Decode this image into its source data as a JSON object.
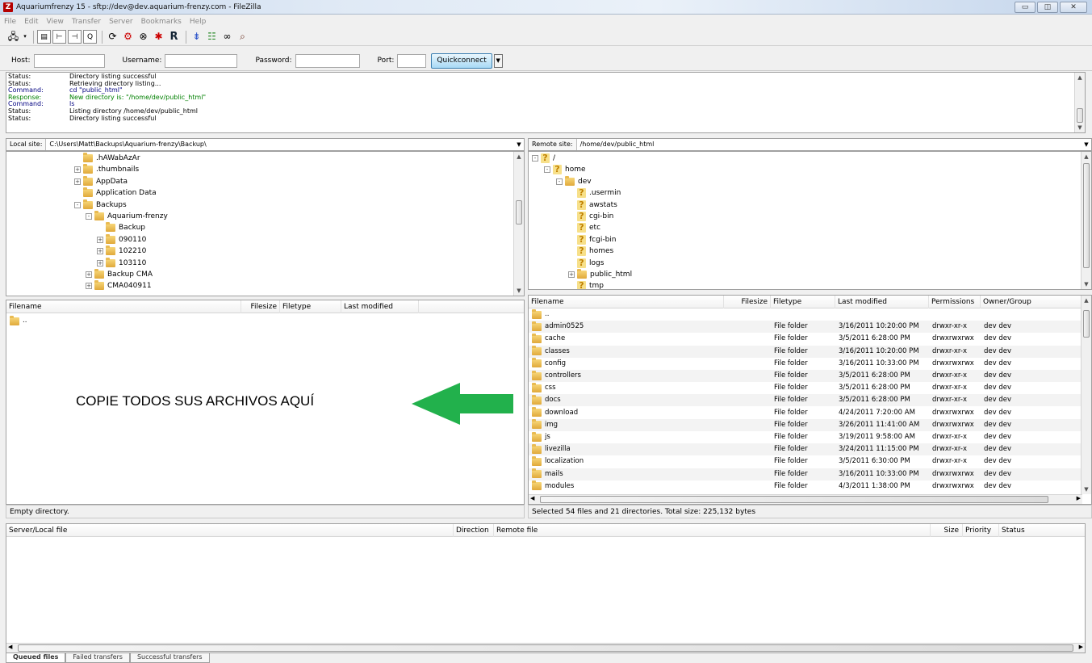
{
  "window": {
    "title": "Aquariumfrenzy 15 - sftp://dev@dev.aquarium-frenzy.com - FileZilla",
    "app_icon": "Z"
  },
  "menu": [
    "File",
    "Edit",
    "View",
    "Transfer",
    "Server",
    "Bookmarks",
    "Help"
  ],
  "quickconnect": {
    "host_label": "Host:",
    "host_value": "",
    "username_label": "Username:",
    "username_value": "",
    "password_label": "Password:",
    "password_value": "",
    "port_label": "Port:",
    "port_value": "",
    "button_label": "Quickconnect"
  },
  "message_log": [
    {
      "type": "Status:",
      "text": "Directory listing successful",
      "color": "black"
    },
    {
      "type": "Status:",
      "text": "Retrieving directory listing...",
      "color": "black"
    },
    {
      "type": "Command:",
      "text": "cd \"public_html\"",
      "color": "blue"
    },
    {
      "type": "Response:",
      "text": "New directory is: \"/home/dev/public_html\"",
      "color": "green"
    },
    {
      "type": "Command:",
      "text": "ls",
      "color": "blue"
    },
    {
      "type": "Status:",
      "text": "Listing directory /home/dev/public_html",
      "color": "black"
    },
    {
      "type": "Status:",
      "text": "Directory listing successful",
      "color": "black"
    }
  ],
  "local": {
    "site_label": "Local site:",
    "site_path": "C:\\Users\\Matt\\Backups\\Aquarium-frenzy\\Backup\\",
    "tree": [
      {
        "label": ".hAWabAzAr",
        "level": 0,
        "exp": ""
      },
      {
        "label": ".thumbnails",
        "level": 0,
        "exp": "+"
      },
      {
        "label": "AppData",
        "level": 0,
        "exp": "+"
      },
      {
        "label": "Application Data",
        "level": 0,
        "exp": ""
      },
      {
        "label": "Backups",
        "level": 0,
        "exp": "-"
      },
      {
        "label": "Aquarium-frenzy",
        "level": 1,
        "exp": "-"
      },
      {
        "label": "Backup",
        "level": 2,
        "exp": ""
      },
      {
        "label": "090110",
        "level": 2,
        "exp": "+"
      },
      {
        "label": "102210",
        "level": 2,
        "exp": "+"
      },
      {
        "label": "103110",
        "level": 2,
        "exp": "+"
      },
      {
        "label": "Backup CMA",
        "level": 1,
        "exp": "+"
      },
      {
        "label": "CMA040911",
        "level": 1,
        "exp": "+"
      }
    ],
    "columns": [
      "Filename",
      "Filesize",
      "Filetype",
      "Last modified"
    ],
    "files": [
      {
        "name": ".."
      }
    ],
    "status": "Empty directory."
  },
  "remote": {
    "site_label": "Remote site:",
    "site_path": "/home/dev/public_html",
    "tree": [
      {
        "label": "/",
        "level": 0,
        "exp": "-"
      },
      {
        "label": "home",
        "level": 1,
        "exp": "-"
      },
      {
        "label": "dev",
        "level": 2,
        "exp": "-",
        "folder": true
      },
      {
        "label": ".usermin",
        "level": 3,
        "exp": ""
      },
      {
        "label": "awstats",
        "level": 3,
        "exp": ""
      },
      {
        "label": "cgi-bin",
        "level": 3,
        "exp": ""
      },
      {
        "label": "etc",
        "level": 3,
        "exp": ""
      },
      {
        "label": "fcgi-bin",
        "level": 3,
        "exp": ""
      },
      {
        "label": "homes",
        "level": 3,
        "exp": ""
      },
      {
        "label": "logs",
        "level": 3,
        "exp": ""
      },
      {
        "label": "public_html",
        "level": 3,
        "exp": "+",
        "folder": true
      },
      {
        "label": "tmp",
        "level": 3,
        "exp": ""
      }
    ],
    "columns": [
      "Filename",
      "Filesize",
      "Filetype",
      "Last modified",
      "Permissions",
      "Owner/Group"
    ],
    "files": [
      {
        "name": "..",
        "type": "",
        "modified": "",
        "perms": "",
        "owner": ""
      },
      {
        "name": "admin0525",
        "type": "File folder",
        "modified": "3/16/2011 10:20:00 PM",
        "perms": "drwxr-xr-x",
        "owner": "dev dev"
      },
      {
        "name": "cache",
        "type": "File folder",
        "modified": "3/5/2011 6:28:00 PM",
        "perms": "drwxrwxrwx",
        "owner": "dev dev"
      },
      {
        "name": "classes",
        "type": "File folder",
        "modified": "3/16/2011 10:20:00 PM",
        "perms": "drwxr-xr-x",
        "owner": "dev dev"
      },
      {
        "name": "config",
        "type": "File folder",
        "modified": "3/16/2011 10:33:00 PM",
        "perms": "drwxrwxrwx",
        "owner": "dev dev"
      },
      {
        "name": "controllers",
        "type": "File folder",
        "modified": "3/5/2011 6:28:00 PM",
        "perms": "drwxr-xr-x",
        "owner": "dev dev"
      },
      {
        "name": "css",
        "type": "File folder",
        "modified": "3/5/2011 6:28:00 PM",
        "perms": "drwxr-xr-x",
        "owner": "dev dev"
      },
      {
        "name": "docs",
        "type": "File folder",
        "modified": "3/5/2011 6:28:00 PM",
        "perms": "drwxr-xr-x",
        "owner": "dev dev"
      },
      {
        "name": "download",
        "type": "File folder",
        "modified": "4/24/2011 7:20:00 AM",
        "perms": "drwxrwxrwx",
        "owner": "dev dev"
      },
      {
        "name": "img",
        "type": "File folder",
        "modified": "3/26/2011 11:41:00 AM",
        "perms": "drwxrwxrwx",
        "owner": "dev dev"
      },
      {
        "name": "js",
        "type": "File folder",
        "modified": "3/19/2011 9:58:00 AM",
        "perms": "drwxr-xr-x",
        "owner": "dev dev"
      },
      {
        "name": "livezilla",
        "type": "File folder",
        "modified": "3/24/2011 11:15:00 PM",
        "perms": "drwxr-xr-x",
        "owner": "dev dev"
      },
      {
        "name": "localization",
        "type": "File folder",
        "modified": "3/5/2011 6:30:00 PM",
        "perms": "drwxr-xr-x",
        "owner": "dev dev"
      },
      {
        "name": "mails",
        "type": "File folder",
        "modified": "3/16/2011 10:33:00 PM",
        "perms": "drwxrwxrwx",
        "owner": "dev dev"
      },
      {
        "name": "modules",
        "type": "File folder",
        "modified": "4/3/2011 1:38:00 PM",
        "perms": "drwxrwxrwx",
        "owner": "dev dev"
      }
    ],
    "status": "Selected 54 files and 21 directories. Total size: 225,132 bytes"
  },
  "annotation": {
    "text": "COPIE TODOS SUS ARCHIVOS AQUÍ",
    "arrow_color": "#22b14c"
  },
  "queue": {
    "columns": [
      "Server/Local file",
      "Direction",
      "Remote file",
      "Size",
      "Priority",
      "Status"
    ],
    "tabs": [
      "Queued files",
      "Failed transfers",
      "Successful transfers"
    ]
  },
  "colors": {
    "command": "#000080",
    "response": "#008000",
    "arrow": "#22b14c"
  }
}
